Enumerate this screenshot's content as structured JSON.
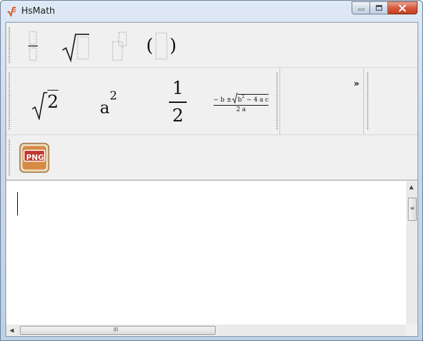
{
  "window": {
    "title": "HsMath",
    "icon": "sqrt-app-icon",
    "controls": [
      "minimize",
      "maximize",
      "close"
    ]
  },
  "toolbar_templates": {
    "items": [
      {
        "name": "fraction-template",
        "icon": "fraction-template-icon"
      },
      {
        "name": "sqrt-template",
        "icon": "sqrt-template-icon"
      },
      {
        "name": "power-template",
        "icon": "power-template-icon"
      },
      {
        "name": "parentheses-template",
        "icon": "parentheses-template-icon"
      }
    ],
    "paren_open": "(",
    "paren_close": ")"
  },
  "toolbar_examples": {
    "sqrt2": {
      "radicand": "2"
    },
    "power": {
      "base": "a",
      "exponent": "2"
    },
    "fraction": {
      "numerator": "1",
      "denominator": "2"
    },
    "quadratic": {
      "prefix": "− b ±",
      "radicand_base": "b",
      "radicand_exp": "2",
      "radicand_rest": "− 4 a c",
      "denominator": "2 a"
    },
    "overflow_label": "»"
  },
  "toolbar_export": {
    "png_label": "PNG"
  },
  "editor": {
    "content": ""
  },
  "scrollbars": {
    "hscroll_grip": "III",
    "vscroll_grip": "≡"
  },
  "colors": {
    "close_button": "#c43e1f",
    "titlebar": "#c9d9ec",
    "png_icon": "#c0392b"
  }
}
